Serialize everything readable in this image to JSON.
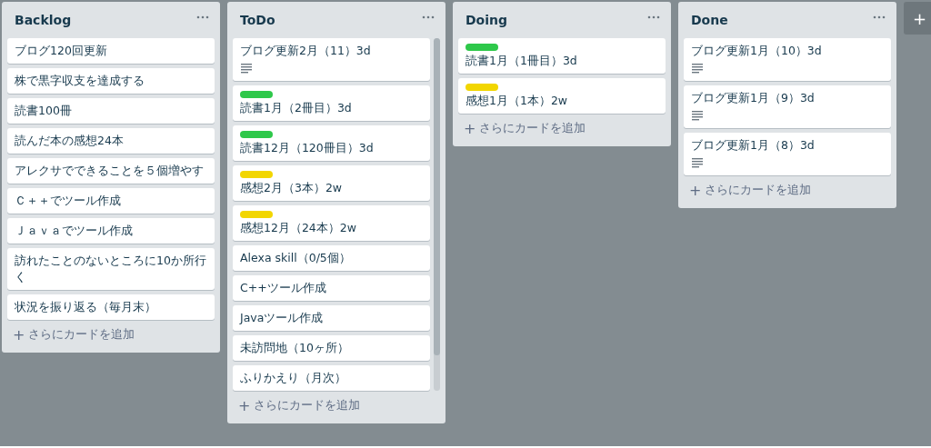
{
  "lists": [
    {
      "title": "Backlog",
      "scrollbar": false,
      "cards": [
        {
          "title": "ブログ120回更新"
        },
        {
          "title": "株で黒字収支を達成する"
        },
        {
          "title": "読書100冊"
        },
        {
          "title": "読んだ本の感想24本"
        },
        {
          "title": "アレクサでできることを５個増やす"
        },
        {
          "title": "Ｃ＋＋でツール作成"
        },
        {
          "title": "Ｊａｖａでツール作成"
        },
        {
          "title": "訪れたことのないところに10か所行く"
        },
        {
          "title": "状況を振り返る（毎月末）"
        }
      ],
      "add_icon": "+",
      "add_label": "さらにカードを追加"
    },
    {
      "title": "ToDo",
      "scrollbar": true,
      "cards": [
        {
          "title": "ブログ更新2月（11）3d",
          "has_description": true
        },
        {
          "title": "読書1月（2冊目）3d",
          "labels": [
            {
              "color": "#2ec84a"
            }
          ]
        },
        {
          "title": "読書12月（120冊目）3d",
          "labels": [
            {
              "color": "#2ec84a"
            }
          ]
        },
        {
          "title": "感想2月（3本）2w",
          "labels": [
            {
              "color": "#f2d600"
            }
          ]
        },
        {
          "title": "感想12月（24本）2w",
          "labels": [
            {
              "color": "#f2d600"
            }
          ]
        },
        {
          "title": "Alexa skill（0/5個）"
        },
        {
          "title": "C++ツール作成"
        },
        {
          "title": "Javaツール作成"
        },
        {
          "title": "未訪問地（10ヶ所）"
        },
        {
          "title": "ふりかえり（月次）"
        }
      ],
      "add_icon": "+",
      "add_label": "さらにカードを追加"
    },
    {
      "title": "Doing",
      "scrollbar": false,
      "cards": [
        {
          "title": "読書1月（1冊目）3d",
          "labels": [
            {
              "color": "#2ec84a"
            }
          ]
        },
        {
          "title": "感想1月（1本）2w",
          "labels": [
            {
              "color": "#f2d600"
            }
          ]
        }
      ],
      "add_icon": "+",
      "add_label": "さらにカードを追加"
    },
    {
      "title": "Done",
      "scrollbar": false,
      "cards": [
        {
          "title": "ブログ更新1月（10）3d",
          "has_description": true
        },
        {
          "title": "ブログ更新1月（9）3d",
          "has_description": true
        },
        {
          "title": "ブログ更新1月（8）3d",
          "has_description": true
        }
      ],
      "add_icon": "+",
      "add_label": "さらにカードを追加"
    }
  ],
  "add_list_button": "+"
}
